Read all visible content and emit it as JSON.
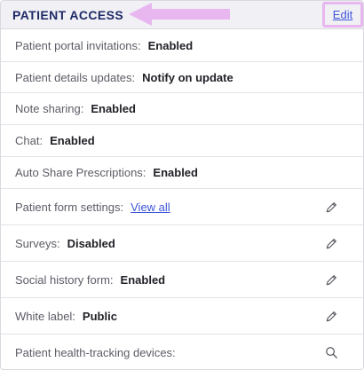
{
  "section": {
    "title": "PATIENT ACCESS",
    "edit_label": "Edit"
  },
  "rows": [
    {
      "label": "Patient portal invitations:",
      "value": "Enabled"
    },
    {
      "label": "Patient details updates:",
      "value": "Notify on update"
    },
    {
      "label": "Note sharing:",
      "value": "Enabled"
    },
    {
      "label": "Chat:",
      "value": "Enabled"
    },
    {
      "label": "Auto Share Prescriptions:",
      "value": "Enabled"
    },
    {
      "label": "Patient form settings:",
      "link": "View all",
      "icon": "pencil-icon"
    },
    {
      "label": "Surveys:",
      "value": "Disabled",
      "icon": "pencil-icon"
    },
    {
      "label": "Social history form:",
      "value": "Enabled",
      "icon": "pencil-icon"
    },
    {
      "label": "White label:",
      "value": "Public",
      "icon": "pencil-icon"
    },
    {
      "label": "Patient health-tracking devices:",
      "icon": "search-icon"
    }
  ],
  "colors": {
    "header_bg": "#f0f0f5",
    "title": "#1f2a66",
    "link": "#3f55d9",
    "annotation": "#e8b7f0"
  }
}
